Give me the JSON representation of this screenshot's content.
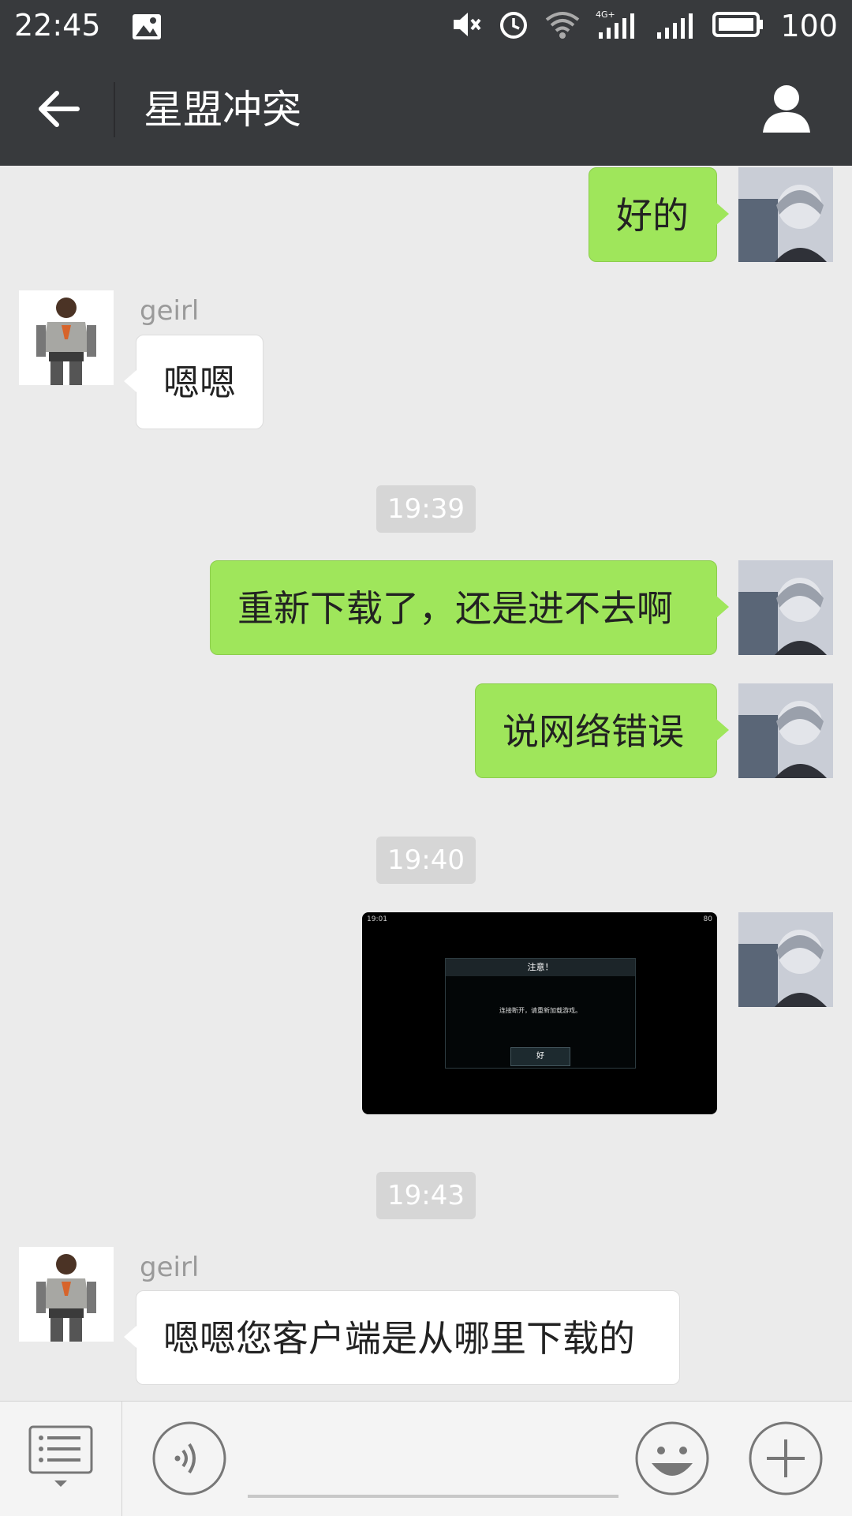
{
  "status_bar": {
    "time": "22:45",
    "battery": "100",
    "network": "4G+",
    "icons": [
      "image-icon",
      "mute-icon",
      "alarm-icon",
      "wifi-icon",
      "signal-4g-icon",
      "signal-icon",
      "battery-icon"
    ]
  },
  "header": {
    "title": "星盟冲突",
    "back_icon": "back-arrow-icon",
    "profile_icon": "person-icon"
  },
  "colors": {
    "header_bg": "#383a3d",
    "chat_bg": "#ebebeb",
    "outgoing_bubble": "#9fe65b",
    "incoming_bubble": "#ffffff"
  },
  "messages": [
    {
      "direction": "out",
      "text": "好的"
    },
    {
      "direction": "in",
      "sender": "geirl",
      "text": "嗯嗯"
    },
    {
      "type": "timestamp",
      "text": "19:39"
    },
    {
      "direction": "out",
      "text": "重新下载了，还是进不去啊"
    },
    {
      "direction": "out",
      "text": "说网络错误"
    },
    {
      "type": "timestamp",
      "text": "19:40"
    },
    {
      "direction": "out",
      "type": "image",
      "image": {
        "status_time": "19:01",
        "status_right": "80",
        "dialog_title": "注意！",
        "dialog_message": "连接断开，请重新加载游戏。",
        "dialog_button": "好"
      }
    },
    {
      "type": "timestamp",
      "text": "19:43"
    },
    {
      "direction": "in",
      "sender": "geirl",
      "text": "嗯嗯您客户端是从哪里下载的"
    }
  ],
  "input_bar": {
    "icons": [
      "menu-list-icon",
      "voice-icon",
      "emoji-icon",
      "plus-icon"
    ],
    "input_value": ""
  }
}
